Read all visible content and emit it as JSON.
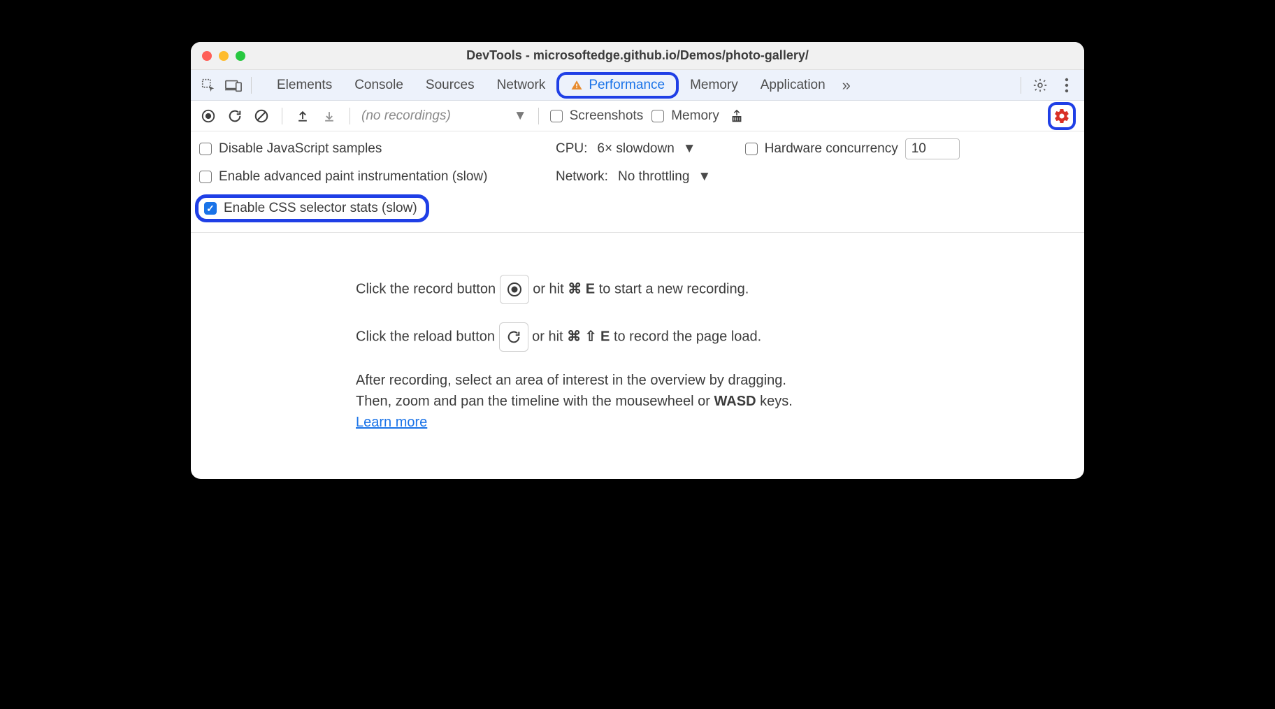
{
  "window": {
    "title": "DevTools - microsoftedge.github.io/Demos/photo-gallery/"
  },
  "tabs": {
    "items": [
      "Elements",
      "Console",
      "Sources",
      "Network",
      "Performance",
      "Memory",
      "Application"
    ],
    "active": "Performance",
    "overflow_glyph": "»"
  },
  "toolbar": {
    "recordings_placeholder": "(no recordings)",
    "screenshots_label": "Screenshots",
    "memory_label": "Memory"
  },
  "settings": {
    "disable_js_label": "Disable JavaScript samples",
    "paint_instr_label": "Enable advanced paint instrumentation (slow)",
    "css_stats_label": "Enable CSS selector stats (slow)",
    "css_stats_checked": true,
    "cpu_label": "CPU:",
    "cpu_value": "6× slowdown",
    "network_label": "Network:",
    "network_value": "No throttling",
    "hw_concurrency_label": "Hardware concurrency",
    "hw_concurrency_value": "10"
  },
  "instructions": {
    "record_pre": "Click the record button ",
    "record_mid": " or hit ",
    "record_keys": "⌘ E",
    "record_post": " to start a new recording.",
    "reload_pre": "Click the reload button ",
    "reload_mid": " or hit ",
    "reload_keys": "⌘ ⇧ E",
    "reload_post": " to record the page load.",
    "drag_line1": "After recording, select an area of interest in the overview by dragging.",
    "drag_line2_pre": "Then, zoom and pan the timeline with the mousewheel or ",
    "drag_line2_kbd": "WASD",
    "drag_line2_post": " keys.",
    "learn_more": "Learn more"
  }
}
